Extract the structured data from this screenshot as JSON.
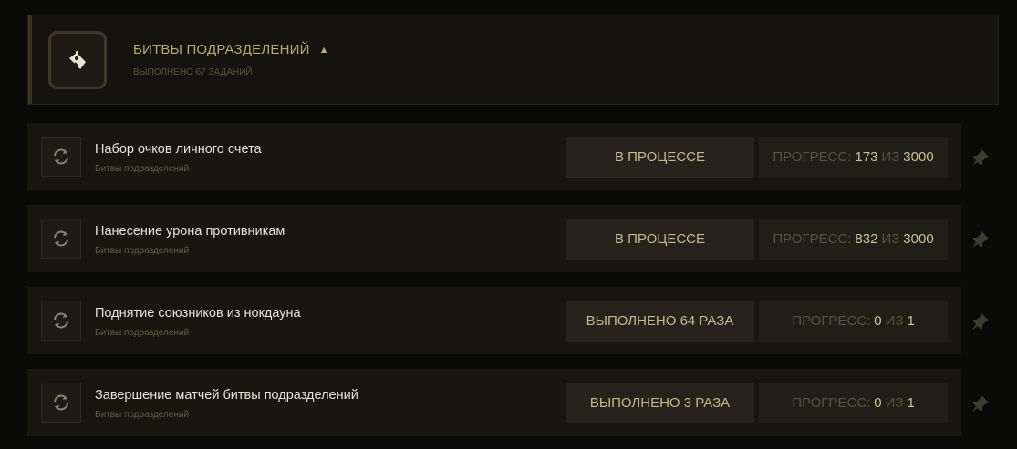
{
  "header": {
    "title": "БИТВЫ ПОДРАЗДЕЛЕНИЙ",
    "caret": "▲",
    "subtitle": "ВЫПОЛНЕНО 67 ЗАДАНИЙ",
    "icon": "unit-battle-icon"
  },
  "progress_label": "ПРОГРЕСС:",
  "progress_of": "ИЗ",
  "tasks": [
    {
      "name": "Набор очков личного счета",
      "category": "Битвы подразделений",
      "status": "В ПРОЦЕССЕ",
      "current": "173",
      "total": "3000"
    },
    {
      "name": "Нанесение урона противникам",
      "category": "Битвы подразделений",
      "status": "В ПРОЦЕССЕ",
      "current": "832",
      "total": "3000"
    },
    {
      "name": "Поднятие союзников из нокдауна",
      "category": "Битвы подразделений",
      "status": "ВЫПОЛНЕНО 64 РАЗА",
      "current": "0",
      "total": "1"
    },
    {
      "name": "Завершение матчей битвы подразделений",
      "category": "Битвы подразделений",
      "status": "ВЫПОЛНЕНО 3 РАЗА",
      "current": "0",
      "total": "1"
    }
  ],
  "icons": {
    "refresh": "refresh-icon",
    "pin": "pin-icon"
  },
  "colors": {
    "accent": "#b9a774",
    "row_bg": "#17160f",
    "text": "#e7e3d8"
  }
}
